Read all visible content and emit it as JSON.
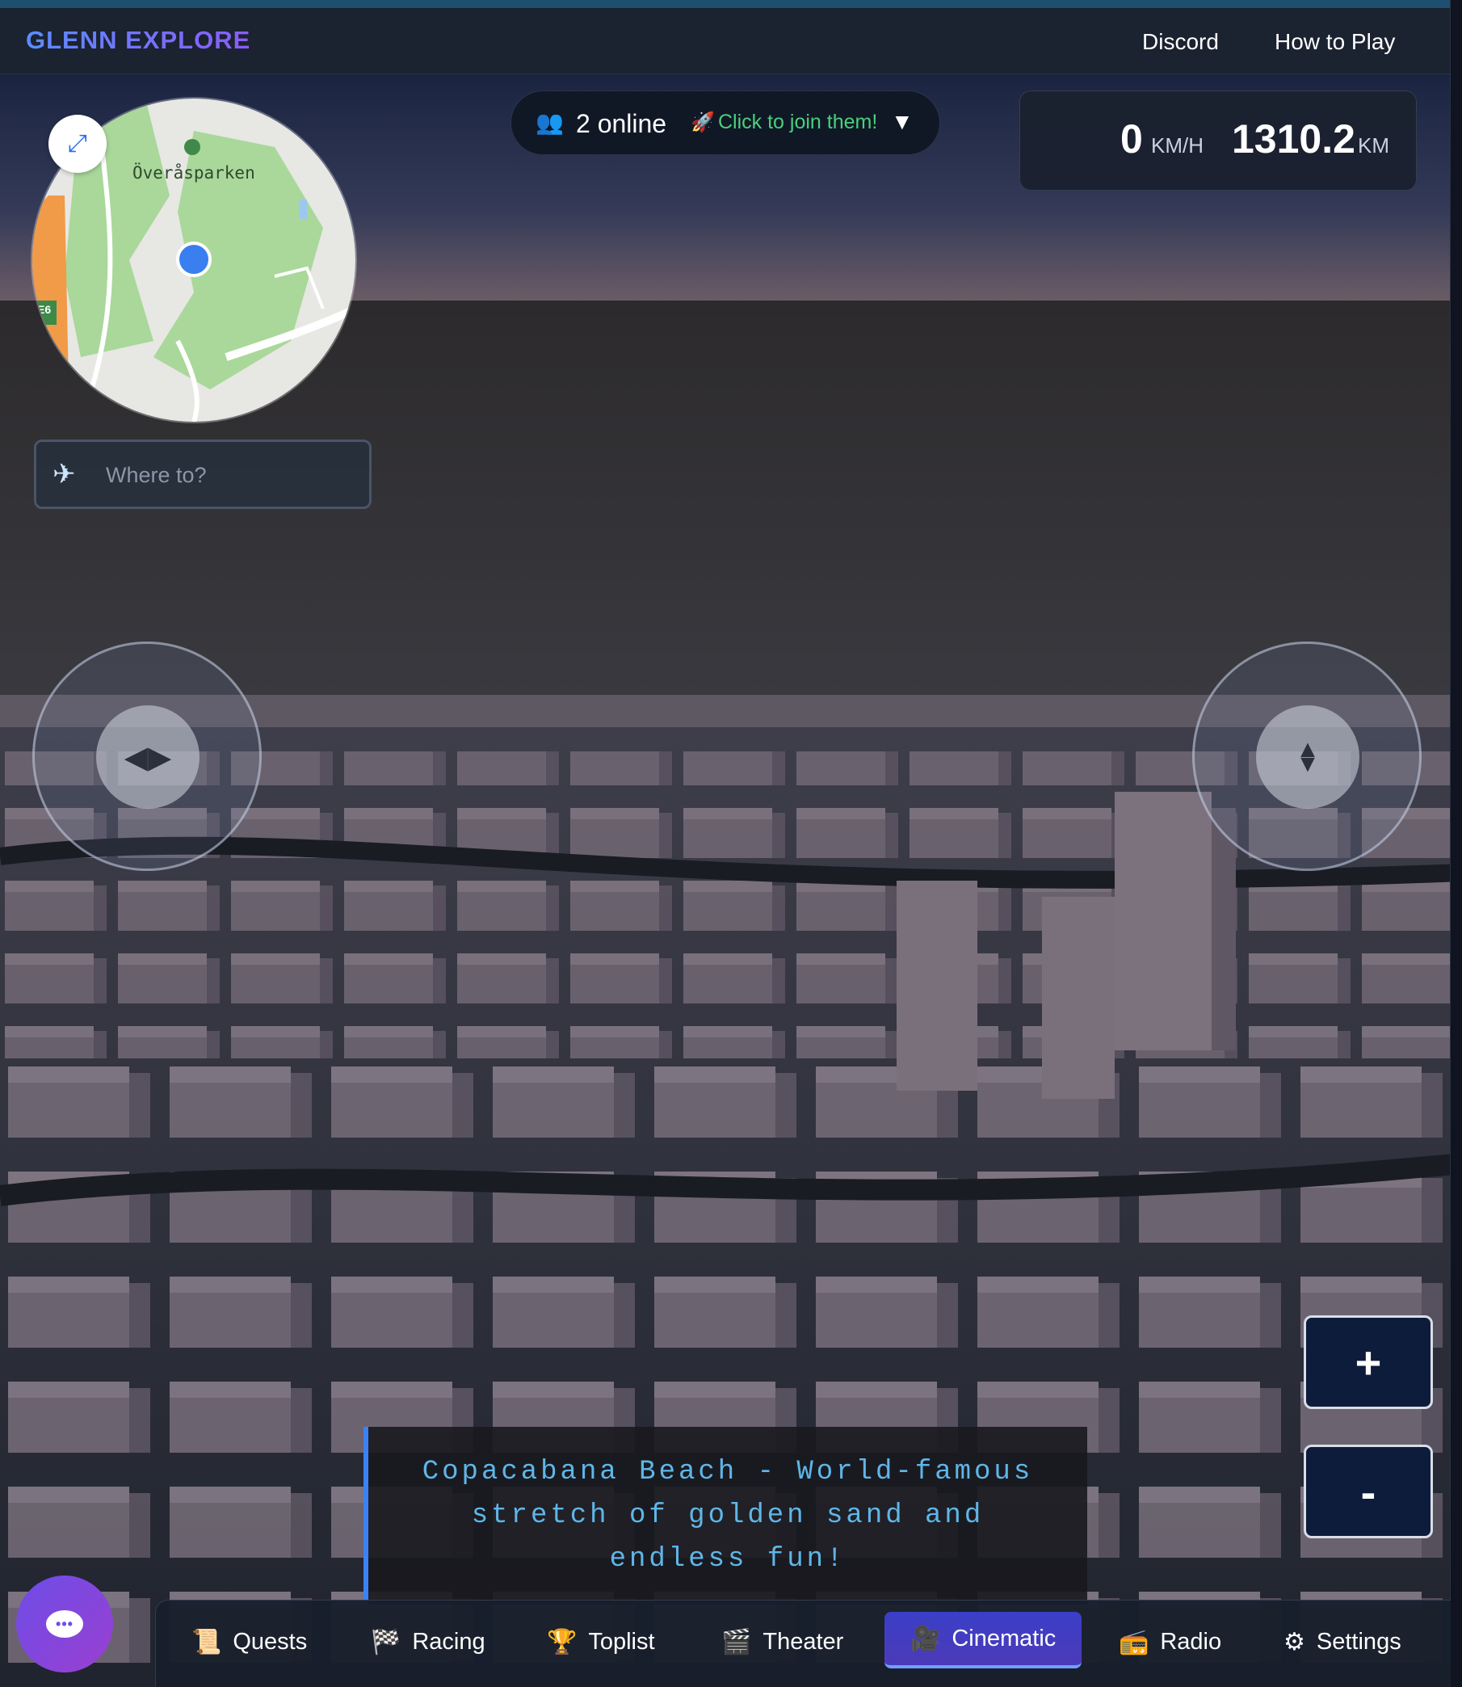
{
  "header": {
    "brand": "GLENN EXPLORE",
    "links": [
      "Discord",
      "How to Play"
    ]
  },
  "minimap": {
    "place_label": "Överåsparken",
    "road_badge": "E6"
  },
  "search": {
    "placeholder": "Where to?",
    "icon": "plane-icon"
  },
  "online": {
    "count_text": "2 online",
    "join_text": "Click to join them!",
    "caret": "▼"
  },
  "stats": {
    "speed": "0",
    "speed_unit": "KM/H",
    "distance": "1310.2",
    "distance_unit": "KM"
  },
  "zoom": {
    "in_label": "+",
    "out_label": "-"
  },
  "caption": {
    "text": "Copacabana Beach - World-famous stretch of golden sand and endless fun!"
  },
  "tabs": [
    {
      "label": "Quests",
      "icon": "scroll-icon",
      "active": false
    },
    {
      "label": "Racing",
      "icon": "checkered-flag-icon",
      "active": false
    },
    {
      "label": "Toplist",
      "icon": "trophy-icon",
      "active": false
    },
    {
      "label": "Theater",
      "icon": "clapperboard-icon",
      "active": false
    },
    {
      "label": "Cinematic",
      "icon": "movie-camera-icon",
      "active": true
    },
    {
      "label": "Radio",
      "icon": "radio-icon",
      "active": false
    },
    {
      "label": "Settings",
      "icon": "gear-icon",
      "active": false
    }
  ],
  "colors": {
    "accent": "#3b82f6",
    "brand_gradient_start": "#5b8cff",
    "brand_gradient_end": "#8a5cf6",
    "online_green": "#4ad07a",
    "caption_text": "#5fb6e8"
  }
}
